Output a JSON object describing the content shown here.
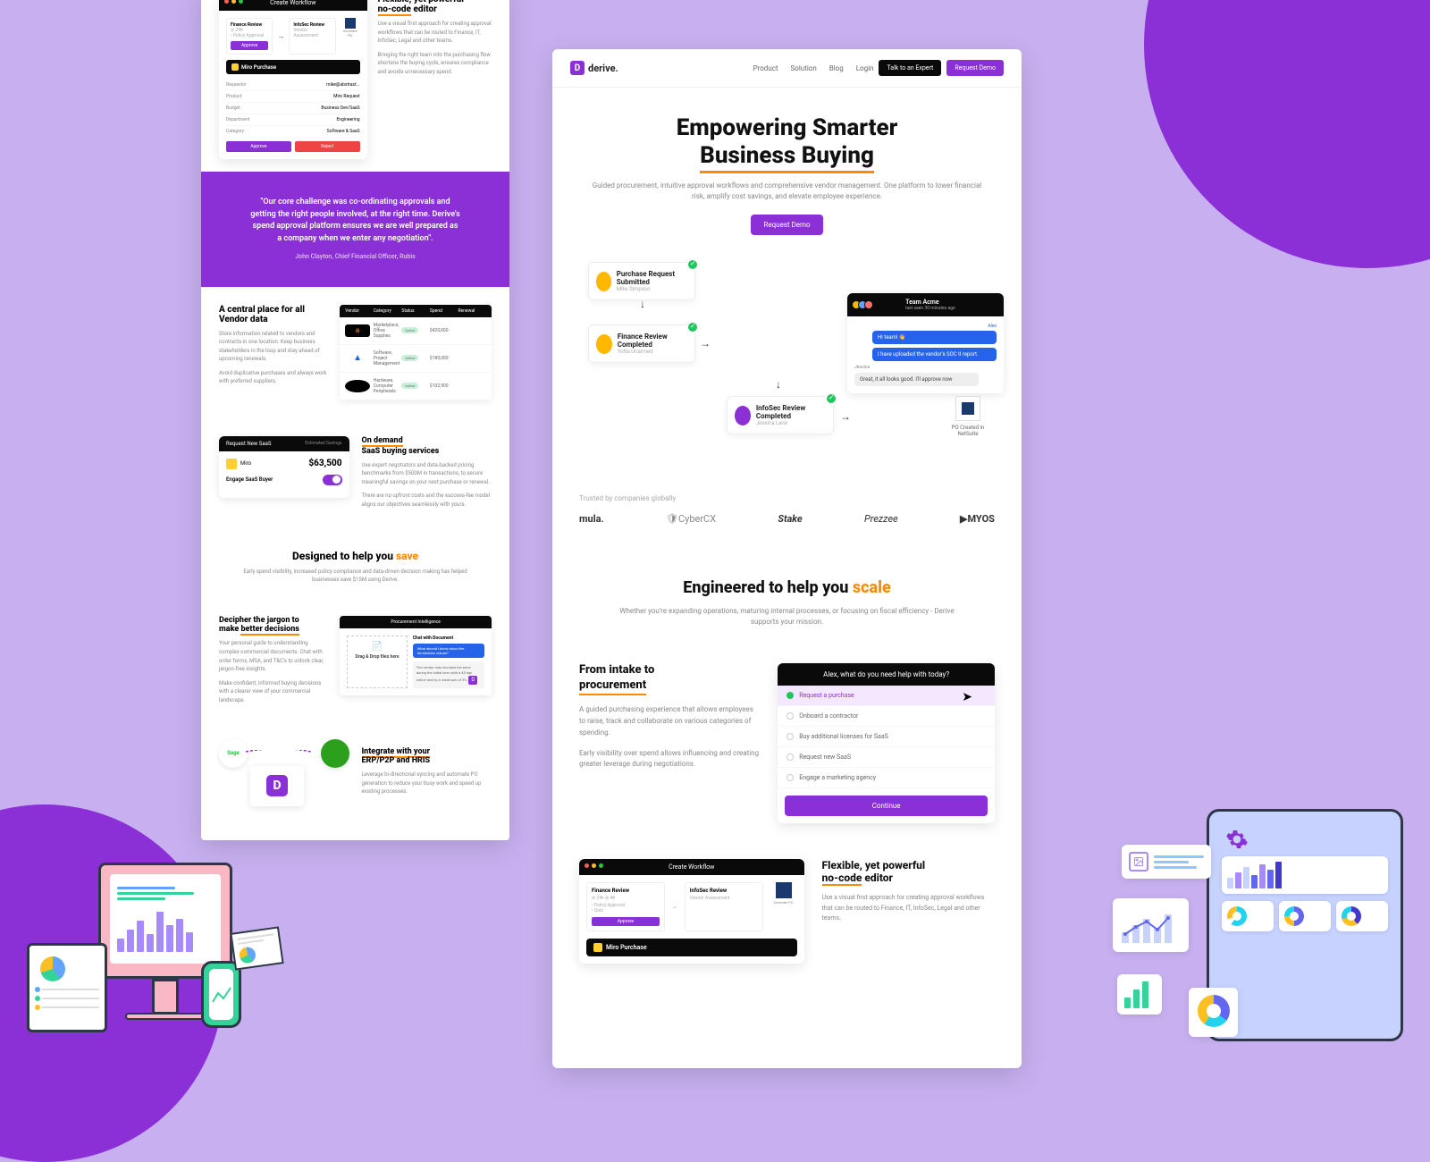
{
  "nav": {
    "brand": "derive.",
    "links": [
      "Product",
      "Solution",
      "Blog"
    ],
    "login": "Login",
    "talk_btn": "Talk to an Expert",
    "demo_btn": "Request Demo"
  },
  "hero": {
    "title_line1": "Empowering Smarter",
    "title_line2": "Business Buying",
    "subtitle": "Guided procurement, intuitive approval workflows and comprehensive vendor management. One platform to lower financial risk, amplify cost savings, and elevate employee experience.",
    "cta": "Request Demo"
  },
  "workflow": {
    "submit": {
      "title": "Purchase Request Submitted",
      "sub": "Mike Simpson"
    },
    "finance": {
      "title": "Finance Review Completed",
      "sub": "Yotta Unarmed"
    },
    "infosec": {
      "title": "InfoSec Review Completed",
      "sub": "Jessica Lane"
    },
    "chat": {
      "team": "Team Acme",
      "sub": "last seen 30 minutes ago",
      "msg1": "Hi team! 👋",
      "msg2": "I have uploaded the vendor's SOC II report.",
      "reply": "Great, it all looks good. I'll approve now"
    },
    "po": "PO Created in NetSuite"
  },
  "trusted": {
    "label": "Trusted by companies globally",
    "logos": [
      "mula.",
      "CyberCX",
      "Stake",
      "Prezzee",
      "MYOS"
    ]
  },
  "engineered": {
    "title_pre": "Engineered to help you ",
    "title_accent": "scale",
    "sub": "Whether you're expanding operations, maturing internal processes, or focusing on fiscal efficiency - Derive supports your mission."
  },
  "intake": {
    "title_line1": "From intake to",
    "title_line2": "procurement",
    "p1": "A guided purchasing experience that allows employees to raise, track and collaborate on various categories of spending.",
    "p2": "Early visibility over spend allows influencing and creating greater leverage during negotiations.",
    "panel_head": "Alex, what do you need help with today?",
    "options": [
      "Request a purchase",
      "Onboard a contractor",
      "Buy additional licenses for SaaS",
      "Request new SaaS",
      "Engage a marketing agency"
    ],
    "continue": "Continue"
  },
  "flexible": {
    "title_pre": "Flexible, yet powerful",
    "title_ul": "no-code",
    "title_post": " editor",
    "p1": "Use a visual first approach for creating approval workflows that can be routed to Finance, IT, InfoSec, Legal and other teams.",
    "p2": "Bringing the right team into the purchasing flow shortens the buying cycle, ensures compliance and avoids unnecessary spend.",
    "wf_title": "Create Workflow",
    "wf_miro": "Miro Purchase"
  },
  "quote": {
    "text": "\"Our core challenge was co-ordinating approvals and getting the right people involved, at the right time. Derive's spend approval platform ensures we are well prepared as a company when we enter any negotiation\".",
    "author": "John Clayton, Chief Financial Officer, Rubis"
  },
  "vendor": {
    "title": "A central place for all Vendor data",
    "p1": "Store information related to vendors and contracts in one location. Keep business stakeholders in the loop and stay ahead of upcoming renewals.",
    "p2": "Avoid duplicative purchases and always work with preferred suppliers.",
    "headers": [
      "Vendor",
      "Category",
      "Status",
      "Spend",
      "Renewal"
    ],
    "rows": [
      {
        "name": "Amazon",
        "cat": "Marketplace, Office Supplies",
        "status": "Active",
        "spend": "$420,000"
      },
      {
        "name": "Atlassian",
        "cat": "Software, Project Management",
        "status": "Active",
        "spend": "$180,000"
      },
      {
        "name": "Dell",
        "cat": "Hardware, Computer Peripherals",
        "status": "Active",
        "spend": "$102,900"
      }
    ]
  },
  "saas": {
    "card_head": "Request New SaaS",
    "est_label": "Estimated Savings",
    "vendor": "Miro",
    "price": "$63,500",
    "engage": "Engage SaaS Buyer",
    "title_pre": "On demand",
    "title_main": "SaaS buying services",
    "p1": "Use expert negotiators and data-backed pricing benchmarks from $500M in transactions, to secure meaningful savings on your next purchase or renewal.",
    "p2": "There are no upfront costs and the success-fee model aligns our objectives seamlessly with yours."
  },
  "designed": {
    "title_pre": "Designed to help you ",
    "title_accent": "save",
    "sub": "Early spend visibility, increased policy compliance and data-driven decision making has helped businesses save $15M using Derive."
  },
  "decipher": {
    "title_line1": "Decipher the jargon to",
    "title_line2_pre": "make ",
    "title_line2_ul": "better decisions",
    "p1": "Your personal guide to understanding complex commercial documents. Chat with order forms, MSA, and T&C's to unlock clear, jargon-free insights.",
    "p2": "Make confident, informed buying decisions with a clearer view of your commercial landscape.",
    "doc_head": "Procurement Intelligence",
    "drop": "Drag & Drop files here",
    "chat_label": "Chat with Document",
    "chat_q": "What should I know about the termination clause?",
    "chat_a": "The vendor may increase the price during the initial term with a 45 day notice and by a maximum of 5%."
  },
  "integrate": {
    "title_line1": "Integrate with your",
    "title_line2": "ERP/P2P and HRIS",
    "p": "Leverage bi-directional syncing and automate PO generation to reduce your busy work and speed up existing processes.",
    "sage": "Sage"
  }
}
